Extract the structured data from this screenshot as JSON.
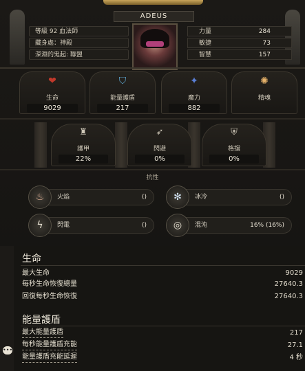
{
  "header": {
    "character_name": "ADEUS"
  },
  "info": {
    "level_class": "等級 92 血法師",
    "hideout": "藏身處：神殿",
    "guild": "深淵的鬼起: 聯盟"
  },
  "attributes": [
    {
      "label": "力量",
      "value": "284"
    },
    {
      "label": "敏捷",
      "value": "73"
    },
    {
      "label": "智慧",
      "value": "157"
    }
  ],
  "main_stats": [
    {
      "label": "生命",
      "value": "9029",
      "icon": "heart-icon"
    },
    {
      "label": "能量護盾",
      "value": "217",
      "icon": "shield-icon"
    },
    {
      "label": "魔力",
      "value": "882",
      "icon": "mana-icon"
    },
    {
      "label": "精魂",
      "value": "",
      "icon": "spirit-icon"
    }
  ],
  "defences": [
    {
      "label": "護甲",
      "value": "22%",
      "icon": "armour-icon"
    },
    {
      "label": "閃避",
      "value": "0%",
      "icon": "evasion-icon"
    },
    {
      "label": "格擋",
      "value": "0%",
      "icon": "block-icon"
    }
  ],
  "resistances": {
    "title": "抗性",
    "items": [
      {
        "label": "火焰",
        "value": "()",
        "icon": "fire-icon"
      },
      {
        "label": "冰冷",
        "value": "()",
        "icon": "cold-icon"
      },
      {
        "label": "閃電",
        "value": "()",
        "icon": "lightning-icon"
      },
      {
        "label": "混沌",
        "value": "16% (16%)",
        "icon": "chaos-icon"
      }
    ]
  },
  "life_section": {
    "title": "生命",
    "rows": [
      {
        "label": "最大生命",
        "value": "9029"
      },
      {
        "label": "每秒生命恢復總量",
        "value": "27640.3"
      },
      {
        "label": "回復每秒生命恢復",
        "value": "27640.3"
      }
    ]
  },
  "es_section": {
    "title": "能量護盾",
    "rows": [
      {
        "label": "最大能量護盾",
        "value": "217"
      },
      {
        "label": "每秒能量護盾充能",
        "value": "27.1"
      },
      {
        "label": "能量護盾充能延遲",
        "value": "4 秒"
      }
    ]
  },
  "colors": {
    "accent_gold": "#c8a45a",
    "life_red": "#c0392b",
    "es_blue": "#5fa8d3"
  }
}
